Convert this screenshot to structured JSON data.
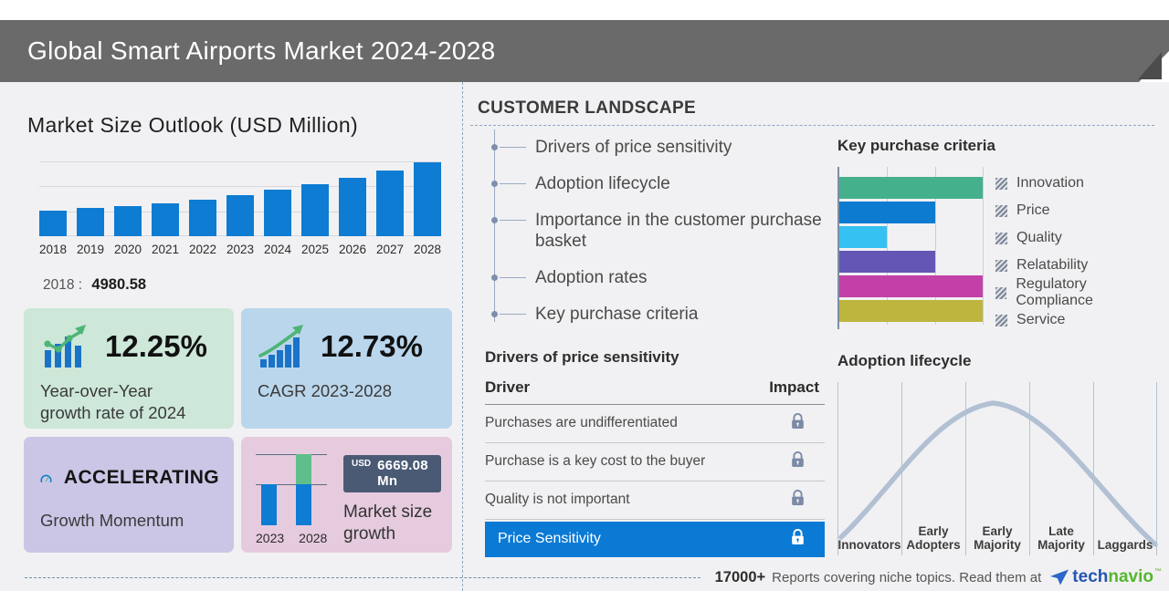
{
  "header": {
    "title": "Global Smart Airports Market 2024-2028"
  },
  "market_outlook": {
    "title": "Market Size Outlook (USD Million)",
    "base_year_label": "2018 :",
    "base_year_value": "4980.58",
    "years": [
      "2018",
      "2019",
      "2020",
      "2021",
      "2022",
      "2023",
      "2024",
      "2025",
      "2026",
      "2027",
      "2028"
    ]
  },
  "cards": {
    "yoy": {
      "value": "12.25%",
      "label": "Year-over-Year\ngrowth rate of 2024"
    },
    "cagr": {
      "value": "12.73%",
      "label": "CAGR 2023-2028"
    },
    "momentum": {
      "status": "ACCELERATING",
      "label": "Growth Momentum"
    },
    "growth": {
      "currency": "USD",
      "amount": "6669.08 Mn",
      "label": "Market size\ngrowth",
      "start_year": "2023",
      "end_year": "2028"
    }
  },
  "customer_landscape": {
    "title": "CUSTOMER LANDSCAPE",
    "items": [
      "Drivers of price sensitivity",
      "Adoption lifecycle",
      "Importance in the customer purchase basket",
      "Adoption rates",
      "Key purchase criteria"
    ]
  },
  "key_purchase_criteria": {
    "title": "Key purchase criteria",
    "legend": [
      "Innovation",
      "Price",
      "Quality",
      "Relatability",
      "Regulatory Compliance",
      "Service"
    ],
    "colors": {
      "innovation": "#45b08c",
      "price": "#0c7bd0",
      "quality": "#35c1f1",
      "relatability": "#6456b4",
      "regulatory_compliance": "#c340a8",
      "service": "#bdb53e"
    }
  },
  "drivers_table": {
    "title": "Drivers of price sensitivity",
    "columns": [
      "Driver",
      "Impact"
    ],
    "rows": [
      "Purchases are undifferentiated",
      "Purchase is a key cost to the buyer",
      "Quality is not important"
    ],
    "highlighted_row": "Price Sensitivity",
    "impact_icon": "lock-icon"
  },
  "adoption_lifecycle": {
    "title": "Adoption lifecycle",
    "stages": [
      "Innovators",
      "Early Adopters",
      "Early Majority",
      "Late Majority",
      "Laggards"
    ]
  },
  "footer": {
    "count": "17000+",
    "text": "Reports covering niche topics. Read them at",
    "brand": {
      "part1": "tech",
      "part2": "navio",
      "tm": "™"
    }
  },
  "colors": {
    "header_bg": "#6a6a6a",
    "content_bg": "#f1f1f3",
    "bar_blue": "#0d7cd2",
    "growth_green": "#5fbe8c",
    "card_green_bg": "#cde7d9",
    "card_blue_bg": "#bad6ec",
    "card_purple_bg": "#cbc6e6",
    "card_pink_bg": "#e6cbdf",
    "badge_bg": "#4a5a74",
    "highlight_row_bg": "#0b7ad5",
    "accent_green": "#4db575",
    "curve": "#b2c0d3",
    "dashed_line": "#7f9ab8",
    "logo_blue": "#2456b0",
    "logo_green": "#54b62e"
  },
  "chart_data": [
    {
      "type": "bar",
      "title": "Market Size Outlook (USD Million)",
      "categories": [
        "2018",
        "2019",
        "2020",
        "2021",
        "2022",
        "2023",
        "2024",
        "2025",
        "2026",
        "2027",
        "2028"
      ],
      "values": [
        4980.58,
        5520,
        6080,
        6690,
        7360,
        8126,
        9120,
        10270,
        11580,
        13090,
        14795
      ],
      "xlabel": "",
      "ylabel": "USD Million",
      "ylim": [
        0,
        15000
      ],
      "grid": "horizontal",
      "annotation": "2018 : 4980.58"
    },
    {
      "type": "bar",
      "orientation": "horizontal",
      "title": "Key purchase criteria",
      "categories": [
        "Innovation",
        "Price",
        "Quality",
        "Relatability",
        "Regulatory Compliance",
        "Service"
      ],
      "values": [
        3,
        2,
        1,
        2,
        3,
        3
      ],
      "xlim": [
        0,
        3
      ],
      "grid": "vertical",
      "legend_position": "right"
    },
    {
      "type": "line",
      "title": "Adoption lifecycle",
      "shape": "bell-curve",
      "x_categories": [
        "Innovators",
        "Early Adopters",
        "Early Majority",
        "Late Majority",
        "Laggards"
      ],
      "peak_at": "Early Majority",
      "grid": "vertical"
    },
    {
      "type": "bar",
      "title": "Market size growth",
      "categories": [
        "2023",
        "2028"
      ],
      "values": [
        8126,
        14795
      ],
      "annotation": "USD 6669.08 Mn",
      "series_note": "2028 bar = 2023 base (blue) + growth segment (green)"
    }
  ]
}
